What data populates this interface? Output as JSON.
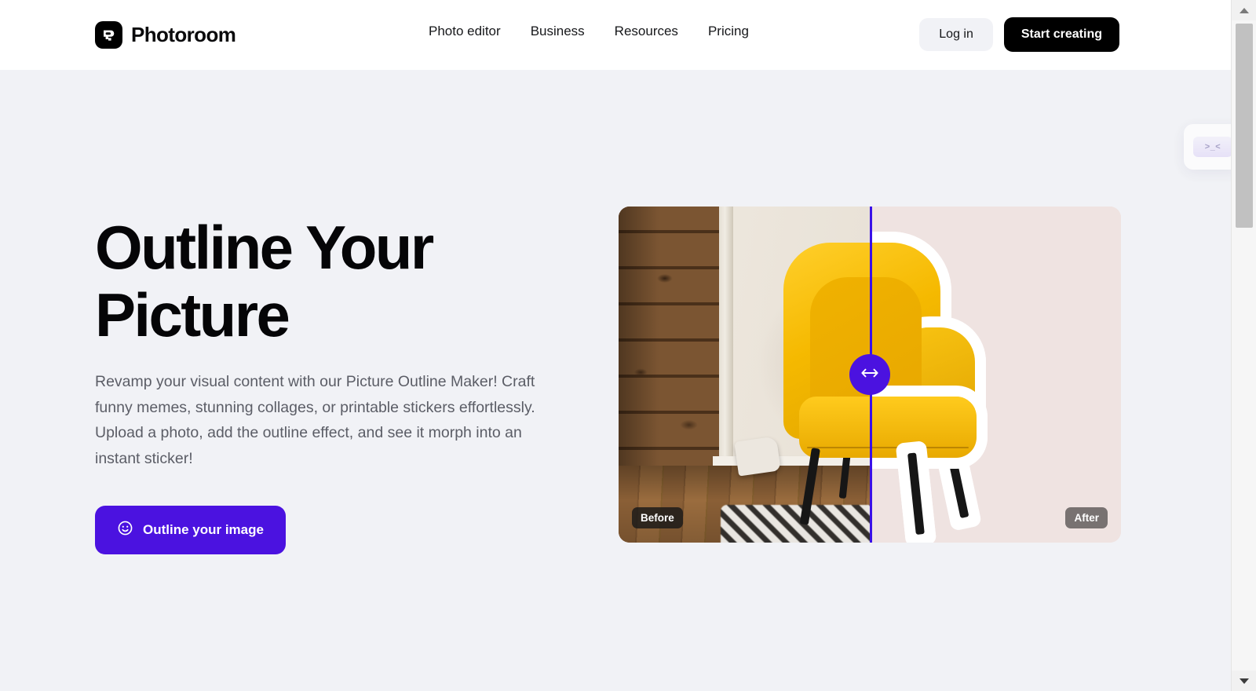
{
  "brand": {
    "name": "Photoroom",
    "mark_icon": "photoroom-logo-icon"
  },
  "nav": {
    "items": [
      {
        "label": "Photo editor"
      },
      {
        "label": "Business"
      },
      {
        "label": "Resources"
      },
      {
        "label": "Pricing"
      }
    ]
  },
  "header_actions": {
    "login_label": "Log in",
    "start_label": "Start creating"
  },
  "hero": {
    "title": "Outline Your\nPicture",
    "subtitle": "Revamp your visual content with our Picture Outline Maker! Craft funny memes, stunning collages, or printable stickers effortlessly. Upload a photo, add the outline effect, and see it morph into an instant sticker!",
    "cta_label": "Outline your image",
    "cta_icon": "smiley-face-icon",
    "cta_color": "#4B12E0"
  },
  "comparison": {
    "before_label": "Before",
    "after_label": "After",
    "slider_percent": 50,
    "handle_icon": "left-right-arrow-icon",
    "handle_color": "#4B12E0",
    "after_background": "#EFE3E1",
    "subject": "yellow armchair"
  },
  "floating_card": {
    "chip_text": ">_<"
  },
  "scrollbar": {
    "up_icon": "triangle-up-icon",
    "down_icon": "triangle-down-icon"
  }
}
